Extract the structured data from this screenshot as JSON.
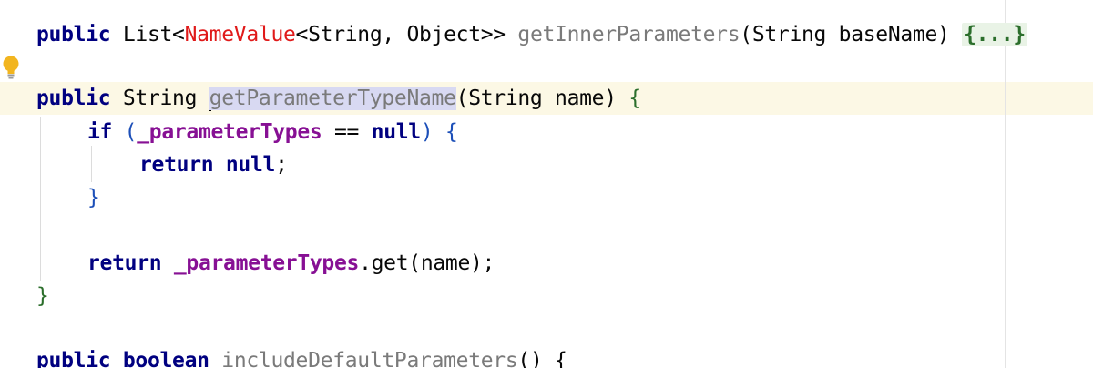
{
  "editor": {
    "line1": {
      "kw_public": "public",
      "type_list": "List<",
      "type_namevalue": "NameValue",
      "generic_rest": "<String, Object>> ",
      "method": "getInnerParameters",
      "params": "(String baseName) ",
      "folded": "{...}"
    },
    "line2": {
      "kw_public": "public",
      "type_string": " String ",
      "method": "getParameterTypeName",
      "params": "(String name) ",
      "brace": "{"
    },
    "line3": {
      "kw_if": "if",
      "open": " (",
      "field": "_parameterTypes",
      "op": " == ",
      "kw_null": "null",
      "close": ") ",
      "brace": "{"
    },
    "line4": {
      "kw_return": "return",
      "space": " ",
      "kw_null": "null",
      "semi": ";"
    },
    "line5": {
      "brace": "}"
    },
    "line6": {
      "kw_return": "return",
      "space": " ",
      "field": "_parameterTypes",
      "call": ".get(name);"
    },
    "line7": {
      "brace": "}"
    },
    "line8": {
      "kw_public": "public",
      "kw_boolean": "boolean",
      "method": "includeDefaultParameters",
      "rest": "() {"
    }
  },
  "colors": {
    "keyword": "#000080",
    "error_type": "#e01a1a",
    "field": "#871094",
    "caret_row": "#fcf8e5",
    "usage_highlight": "#d8d9f2",
    "folded_bg": "#e9f3e6"
  },
  "icons": {
    "intention_bulb": "lightbulb-icon"
  }
}
